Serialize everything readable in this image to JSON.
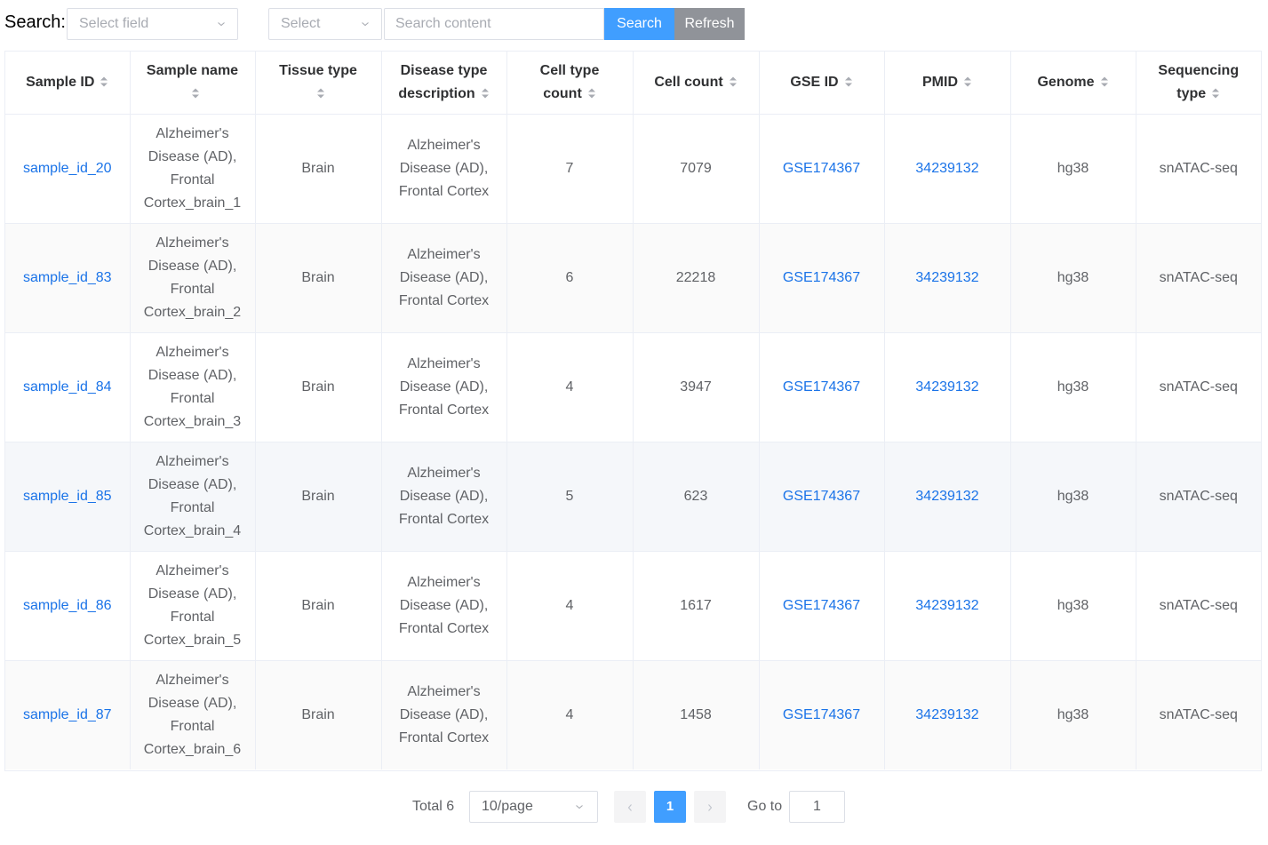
{
  "search": {
    "label": "Search:",
    "field_placeholder": "Select field",
    "operator_placeholder": "Select",
    "content_placeholder": "Search content",
    "search_button": "Search",
    "refresh_button": "Refresh"
  },
  "table": {
    "columns": [
      {
        "line1": "Sample ID",
        "line2": ""
      },
      {
        "line1": "Sample name",
        "line2": ""
      },
      {
        "line1": "Tissue type",
        "line2": ""
      },
      {
        "line1": "Disease type",
        "line2": "description"
      },
      {
        "line1": "Cell type",
        "line2": "count"
      },
      {
        "line1": "Cell count",
        "line2": ""
      },
      {
        "line1": "GSE ID",
        "line2": ""
      },
      {
        "line1": "PMID",
        "line2": ""
      },
      {
        "line1": "Genome",
        "line2": ""
      },
      {
        "line1": "Sequencing",
        "line2": "type"
      }
    ],
    "rows": [
      {
        "sample_id": "sample_id_20",
        "sample_name": [
          "Alzheimer's",
          "Disease (AD),",
          "Frontal",
          "Cortex_brain_1"
        ],
        "tissue": "Brain",
        "disease": [
          "Alzheimer's",
          "Disease (AD),",
          "Frontal Cortex"
        ],
        "cell_type_count": "7",
        "cell_count": "7079",
        "gse_id": "GSE174367",
        "pmid": "34239132",
        "genome": "hg38",
        "seq_type": "snATAC-seq"
      },
      {
        "sample_id": "sample_id_83",
        "sample_name": [
          "Alzheimer's",
          "Disease (AD),",
          "Frontal",
          "Cortex_brain_2"
        ],
        "tissue": "Brain",
        "disease": [
          "Alzheimer's",
          "Disease (AD),",
          "Frontal Cortex"
        ],
        "cell_type_count": "6",
        "cell_count": "22218",
        "gse_id": "GSE174367",
        "pmid": "34239132",
        "genome": "hg38",
        "seq_type": "snATAC-seq"
      },
      {
        "sample_id": "sample_id_84",
        "sample_name": [
          "Alzheimer's",
          "Disease (AD),",
          "Frontal",
          "Cortex_brain_3"
        ],
        "tissue": "Brain",
        "disease": [
          "Alzheimer's",
          "Disease (AD),",
          "Frontal Cortex"
        ],
        "cell_type_count": "4",
        "cell_count": "3947",
        "gse_id": "GSE174367",
        "pmid": "34239132",
        "genome": "hg38",
        "seq_type": "snATAC-seq"
      },
      {
        "sample_id": "sample_id_85",
        "sample_name": [
          "Alzheimer's",
          "Disease (AD),",
          "Frontal",
          "Cortex_brain_4"
        ],
        "tissue": "Brain",
        "disease": [
          "Alzheimer's",
          "Disease (AD),",
          "Frontal Cortex"
        ],
        "cell_type_count": "5",
        "cell_count": "623",
        "gse_id": "GSE174367",
        "pmid": "34239132",
        "genome": "hg38",
        "seq_type": "snATAC-seq"
      },
      {
        "sample_id": "sample_id_86",
        "sample_name": [
          "Alzheimer's",
          "Disease (AD),",
          "Frontal",
          "Cortex_brain_5"
        ],
        "tissue": "Brain",
        "disease": [
          "Alzheimer's",
          "Disease (AD),",
          "Frontal Cortex"
        ],
        "cell_type_count": "4",
        "cell_count": "1617",
        "gse_id": "GSE174367",
        "pmid": "34239132",
        "genome": "hg38",
        "seq_type": "snATAC-seq"
      },
      {
        "sample_id": "sample_id_87",
        "sample_name": [
          "Alzheimer's",
          "Disease (AD),",
          "Frontal",
          "Cortex_brain_6"
        ],
        "tissue": "Brain",
        "disease": [
          "Alzheimer's",
          "Disease (AD),",
          "Frontal Cortex"
        ],
        "cell_type_count": "4",
        "cell_count": "1458",
        "gse_id": "GSE174367",
        "pmid": "34239132",
        "genome": "hg38",
        "seq_type": "snATAC-seq"
      }
    ]
  },
  "pagination": {
    "total": "Total 6",
    "page_size": "10/page",
    "current_page": "1",
    "goto_label": "Go to",
    "goto_value": "1"
  },
  "colors": {
    "primary": "#409eff",
    "link": "#1a73e8",
    "refresh": "#909399"
  },
  "icons": [
    "chevron-down-icon",
    "sort-caret-icon",
    "chevron-left-icon",
    "chevron-right-icon"
  ]
}
